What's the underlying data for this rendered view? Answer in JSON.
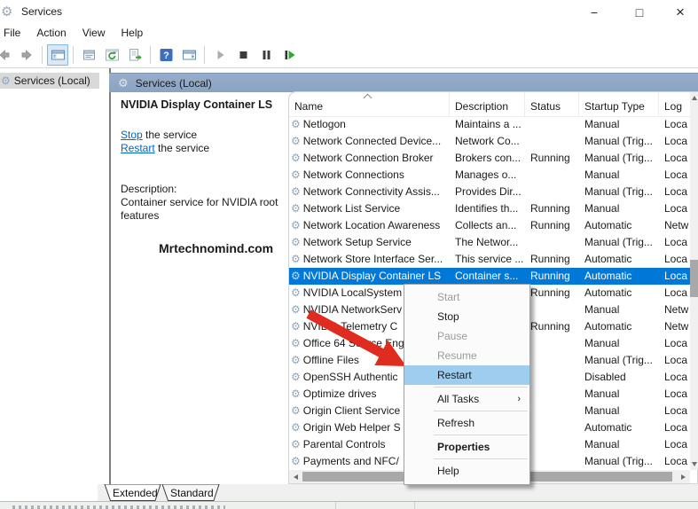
{
  "window_title": "Services",
  "title_bar": {
    "minimize_glyph": "−",
    "maximize_glyph": "□",
    "close_glyph": "×"
  },
  "menu_bar": [
    "File",
    "Action",
    "View",
    "Help"
  ],
  "toolbar": {
    "groups": [
      [
        "back-arrow-icon",
        "forward-arrow-icon"
      ],
      [
        "console-tree-icon"
      ],
      [
        "properties-window-icon",
        "refresh-icon",
        "export-list-icon"
      ],
      [
        "help-icon",
        "action-pane-icon"
      ],
      [
        "start-service-icon",
        "stop-service-icon",
        "pause-service-icon",
        "restart-service-icon"
      ]
    ],
    "active_icon": "console-tree-icon"
  },
  "tree_panel": {
    "selected_item": "Services (Local)"
  },
  "pane_header": {
    "title": "Services (Local)"
  },
  "detail_panel": {
    "service_title": "NVIDIA Display Container LS",
    "stop_link": "Stop",
    "stop_suffix": " the service",
    "restart_link": "Restart",
    "restart_suffix": " the service",
    "description_label": "Description:",
    "description_line1": "Container service for NVIDIA root",
    "description_line2": "features",
    "watermark": "Mrtechnomind.com"
  },
  "services_list": {
    "columns": [
      "Name",
      "Description",
      "Status",
      "Startup Type",
      "Log"
    ],
    "rows": [
      {
        "name": "Netlogon",
        "description": "Maintains a ...",
        "status": "",
        "startup": "Manual",
        "log": "Loca",
        "selected": false
      },
      {
        "name": "Network Connected Device...",
        "description": "Network Co...",
        "status": "",
        "startup": "Manual (Trig...",
        "log": "Loca",
        "selected": false
      },
      {
        "name": "Network Connection Broker",
        "description": "Brokers con...",
        "status": "Running",
        "startup": "Manual (Trig...",
        "log": "Loca",
        "selected": false
      },
      {
        "name": "Network Connections",
        "description": "Manages o...",
        "status": "",
        "startup": "Manual",
        "log": "Loca",
        "selected": false
      },
      {
        "name": "Network Connectivity Assis...",
        "description": "Provides Dir...",
        "status": "",
        "startup": "Manual (Trig...",
        "log": "Loca",
        "selected": false
      },
      {
        "name": "Network List Service",
        "description": "Identifies th...",
        "status": "Running",
        "startup": "Manual",
        "log": "Loca",
        "selected": false
      },
      {
        "name": "Network Location Awareness",
        "description": "Collects an...",
        "status": "Running",
        "startup": "Automatic",
        "log": "Netw",
        "selected": false
      },
      {
        "name": "Network Setup Service",
        "description": "The Networ...",
        "status": "",
        "startup": "Manual (Trig...",
        "log": "Loca",
        "selected": false
      },
      {
        "name": "Network Store Interface Ser...",
        "description": "This service ...",
        "status": "Running",
        "startup": "Automatic",
        "log": "Loca",
        "selected": false
      },
      {
        "name": "NVIDIA Display Container LS",
        "description": "Container s...",
        "status": "Running",
        "startup": "Automatic",
        "log": "Loca",
        "selected": true
      },
      {
        "name": "NVIDIA LocalSystem",
        "description": "",
        "status": "Running",
        "startup": "Automatic",
        "log": "Loca",
        "selected": false
      },
      {
        "name": "NVIDIA NetworkServ",
        "description": "",
        "status": "",
        "startup": "Manual",
        "log": "Netw",
        "selected": false
      },
      {
        "name": "NVIDIA Telemetry C",
        "description": "",
        "status": "Running",
        "startup": "Automatic",
        "log": "Netw",
        "selected": false
      },
      {
        "name": "Office 64 Source Eng",
        "description": "",
        "status": "",
        "startup": "Manual",
        "log": "Loca",
        "selected": false
      },
      {
        "name": "Offline Files",
        "description": "",
        "status": "",
        "startup": "Manual (Trig...",
        "log": "Loca",
        "selected": false
      },
      {
        "name": "OpenSSH Authentic",
        "description": "",
        "status": "",
        "startup": "Disabled",
        "log": "Loca",
        "selected": false
      },
      {
        "name": "Optimize drives",
        "description": "",
        "status": "",
        "startup": "Manual",
        "log": "Loca",
        "selected": false
      },
      {
        "name": "Origin Client Service",
        "description": "",
        "status": "",
        "startup": "Manual",
        "log": "Loca",
        "selected": false
      },
      {
        "name": "Origin Web Helper S",
        "description": "",
        "status": "",
        "startup": "Automatic",
        "log": "Loca",
        "selected": false
      },
      {
        "name": "Parental Controls",
        "description": "",
        "status": "",
        "startup": "Manual",
        "log": "Loca",
        "selected": false
      },
      {
        "name": "Payments and NFC/",
        "description": "",
        "status": "",
        "startup": "Manual (Trig...",
        "log": "Loca",
        "selected": false
      }
    ]
  },
  "context_menu": {
    "items": [
      {
        "label": "Start",
        "state": "disabled"
      },
      {
        "label": "Stop",
        "state": "normal"
      },
      {
        "label": "Pause",
        "state": "disabled"
      },
      {
        "label": "Resume",
        "state": "disabled"
      },
      {
        "label": "Restart",
        "state": "highlighted"
      },
      {
        "separator": true
      },
      {
        "label": "All Tasks",
        "state": "normal",
        "submenu": true
      },
      {
        "separator": true
      },
      {
        "label": "Refresh",
        "state": "normal"
      },
      {
        "separator": true
      },
      {
        "label": "Properties",
        "state": "normal",
        "bold": true
      },
      {
        "separator": true
      },
      {
        "label": "Help",
        "state": "normal"
      }
    ],
    "submenu_glyph": "›"
  },
  "tabs": {
    "items": [
      "Extended",
      "Standard"
    ],
    "selected": "Extended"
  },
  "colors": {
    "selection_blue": "#0078d7",
    "menu_highlight_blue": "#9ecdf0",
    "pane_header_blue": "#8fa5c1",
    "annotation_red": "#e02b20",
    "link_blue": "#0563c1"
  }
}
